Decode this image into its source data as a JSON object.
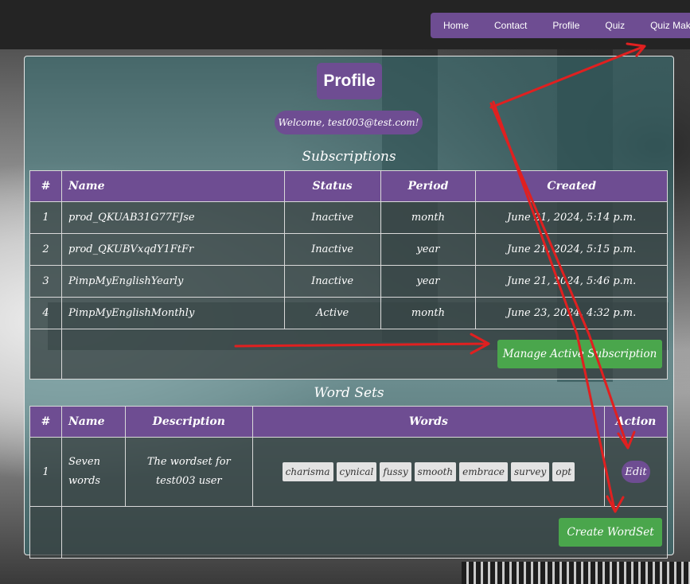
{
  "nav": {
    "items": [
      {
        "label": "Home"
      },
      {
        "label": "Contact"
      },
      {
        "label": "Profile"
      },
      {
        "label": "Quiz"
      },
      {
        "label": "Quiz Maker"
      }
    ]
  },
  "profile": {
    "title": "Profile",
    "welcome": "Welcome, test003@test.com!"
  },
  "subscriptions": {
    "title": "Subscriptions",
    "headers": [
      "#",
      "Name",
      "Status",
      "Period",
      "Created"
    ],
    "rows": [
      {
        "num": "1",
        "name": "prod_QKUAB31G77FJse",
        "status": "Inactive",
        "period": "month",
        "created": "June 21, 2024, 5:14 p.m."
      },
      {
        "num": "2",
        "name": "prod_QKUBVxqdY1FtFr",
        "status": "Inactive",
        "period": "year",
        "created": "June 21, 2024, 5:15 p.m."
      },
      {
        "num": "3",
        "name": "PimpMyEnglishYearly",
        "status": "Inactive",
        "period": "year",
        "created": "June 21, 2024, 5:46 p.m."
      },
      {
        "num": "4",
        "name": "PimpMyEnglishMonthly",
        "status": "Active",
        "period": "month",
        "created": "June 23, 2024, 4:32 p.m."
      }
    ],
    "manage_button": "Manage Active Subscription"
  },
  "wordsets": {
    "title": "Word Sets",
    "headers": [
      "#",
      "Name",
      "Description",
      "Words",
      "Action"
    ],
    "rows": [
      {
        "num": "1",
        "name": "Seven words",
        "description": "The wordset for test003 user",
        "words": [
          "charisma",
          "cynical",
          "fussy",
          "smooth",
          "embrace",
          "survey",
          "opt"
        ],
        "edit": "Edit"
      }
    ],
    "create_button": "Create WordSet"
  },
  "colors": {
    "accent": "#6e4d92",
    "success": "#4aa64c",
    "annotation": "#e02020"
  }
}
